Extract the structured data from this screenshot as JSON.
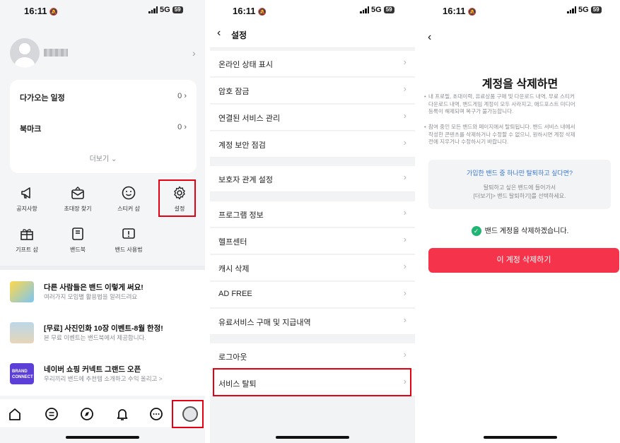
{
  "s1": {
    "status": {
      "time": "16:11",
      "network": "5G",
      "battery": "59"
    },
    "menu": {
      "upcoming_label": "다가오는 일정",
      "upcoming_count": "0",
      "bookmark_label": "북마크",
      "bookmark_count": "0",
      "more": "더보기"
    },
    "grid": [
      {
        "label": "공지사항",
        "icon": "megaphone-icon"
      },
      {
        "label": "초대장 찾기",
        "icon": "invite-mail-icon"
      },
      {
        "label": "스티커 샵",
        "icon": "smiley-icon"
      },
      {
        "label": "설정",
        "icon": "gear-icon"
      },
      {
        "label": "기프트 샵",
        "icon": "gift-icon"
      },
      {
        "label": "밴드북",
        "icon": "book-icon"
      },
      {
        "label": "밴드 사용법",
        "icon": "help-book-icon"
      }
    ],
    "banners": [
      {
        "title": "다른 사람들은 밴드 이렇게 써요!",
        "desc": "여러가지 모임별 활용법을 알려드려요"
      },
      {
        "title": "[무료] 사진인화 10장 이벤트-8월 한정!",
        "desc": "본 무료 이벤트는 밴드북에서 제공합니다."
      },
      {
        "title": "네이버 쇼핑 커넥트 그랜드 오픈",
        "desc": "우리끼리 밴드에 추천템 소개하고 수익 올리고 >",
        "thumb_text": "BRAND CONNECT"
      }
    ],
    "tabs": [
      "home-icon",
      "feed-icon",
      "explore-icon",
      "notification-icon",
      "chat-icon",
      "profile-icon"
    ]
  },
  "s2": {
    "status": {
      "time": "16:11",
      "network": "5G",
      "battery": "59"
    },
    "header": {
      "title": "설정"
    },
    "items": [
      "온라인 상태 표시",
      "암호 잠금",
      "연결된 서비스 관리",
      "계정 보안 점검",
      "보호자 관계 설정",
      "프로그램 정보",
      "헬프센터",
      "캐시 삭제",
      "AD FREE",
      "유료서비스 구매 및 지급내역",
      "로그아웃",
      "서비스 탈퇴"
    ]
  },
  "s3": {
    "status": {
      "time": "16:11",
      "network": "5G",
      "battery": "59"
    },
    "title": "계정을 삭제하면",
    "bullet1": [
      "내 프로필, 초대이력, 유료상품 구매 및 다운로드 내역, 무료 스티커",
      "다운로드 내역, 밴드게임 계정이 모두 사라지고, 애드포스트 미디어",
      "등록이 해제되며 복구가 불가능합니다."
    ],
    "bullet2": [
      "참여 중인 모든 밴드와 페이지에서 탈퇴됩니다. 밴드 서비스 내에서",
      "작성한 콘텐츠를 삭제하거나 수정할 수 없으니, 원하시면 계정 삭제",
      "전에 지우거나 수정하시기 바랍니다."
    ],
    "info": {
      "question": "가입한 밴드 중 하나만 탈퇴하고 싶다면?",
      "desc1": "탈퇴하고 싶은 밴드에 들어가서",
      "desc2": "[더보기]> 밴드 탈퇴하기]를 선택하세요."
    },
    "agree": "밴드 계정을 삭제하겠습니다.",
    "delete_button": "이 계정 삭제하기"
  }
}
